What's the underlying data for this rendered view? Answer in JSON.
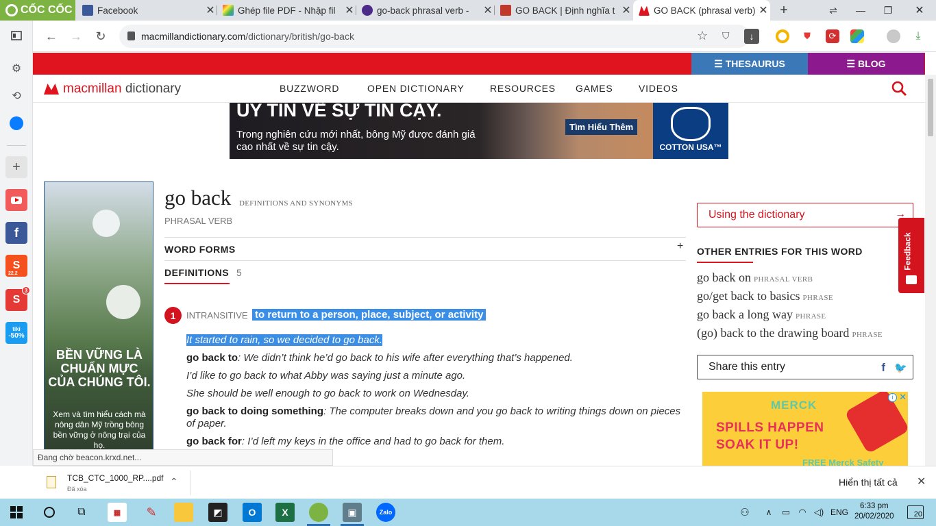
{
  "tabs": [
    {
      "title": "Facebook",
      "icon": "facebook-icon",
      "color": "#3b5998"
    },
    {
      "title": "Ghép file PDF - Nhập fil",
      "icon": "pdf-tool-icon",
      "color": "#e4405f"
    },
    {
      "title": "go-back phrasal verb - ",
      "icon": "oxford-icon",
      "color": "#4b2a8a"
    },
    {
      "title": "GO BACK | Định nghĩa t",
      "icon": "cambridge-icon",
      "color": "#c0392b"
    },
    {
      "title": "GO BACK (phrasal verb)",
      "icon": "macmillan-icon",
      "color": "#e0141e"
    }
  ],
  "browser": {
    "brand": "CỐC CỐC",
    "url_domain": "macmillandictionary.com",
    "url_path": "/dictionary/british/go-back"
  },
  "site": {
    "logo_a": "macmillan",
    "logo_b": "dictionary",
    "thesaurus": "THESAURUS",
    "blog": "BLOG",
    "nav": [
      "BUZZWORD",
      "OPEN DICTIONARY",
      "RESOURCES",
      "GAMES",
      "VIDEOS"
    ]
  },
  "top_ad": {
    "headline": "UY TÍN VỀ SỰ TIN CẬY.",
    "body": "Trong nghiên cứu mới nhất, bông Mỹ được đánh giá cao nhất về sự tin cậy.",
    "cta": "Tìm Hiểu Thêm",
    "brand": "COTTON USA™"
  },
  "left_ad": {
    "headline": "BỀN VỮNG LÀ CHUẨN MỰC CỦA CHÚNG TÔI.",
    "body": "Xem và tìm hiểu cách mà nông dân Mỹ trồng bông bền vững ở nông trại của họ."
  },
  "entry": {
    "word": "go back",
    "word_sub": "DEFINITIONS AND SYNONYMS",
    "pos": "PHRASAL VERB",
    "word_forms": "WORD FORMS",
    "definitions_label": "DEFINITIONS",
    "definitions_count": "5",
    "sense_number": "1",
    "grammar": "INTRANSITIVE",
    "definition": "to return to a person, place, subject, or activity",
    "examples": [
      {
        "pattern": "",
        "text": "It started to rain, so we decided to go back."
      },
      {
        "pattern": "go back to",
        "text": ": We didn’t think he’d go back to his wife after everything that’s happened."
      },
      {
        "pattern": "",
        "text": "I’d like to go back to what Abby was saying just a minute ago."
      },
      {
        "pattern": "",
        "text": "She should be well enough to go back to work on Wednesday."
      },
      {
        "pattern": "go back to doing something",
        "text": ": The computer breaks down and you go back to writing things down on pieces of paper."
      },
      {
        "pattern": "go back for",
        "text": ": I’d left my keys in the office and had to go back for them."
      }
    ]
  },
  "right": {
    "using": "Using the dictionary",
    "other_heading": "OTHER ENTRIES FOR THIS WORD",
    "other_entries": [
      {
        "text": "go back on",
        "pos": "PHRASAL VERB"
      },
      {
        "text": "go/get back to basics",
        "pos": "PHRASE"
      },
      {
        "text": "go back a long way",
        "pos": "PHRASE"
      },
      {
        "text": "(go) back to the drawing board",
        "pos": "PHRASE"
      }
    ],
    "share": "Share this entry"
  },
  "merck_ad": {
    "brand": "MERCK",
    "line1": "SPILLS HAPPEN",
    "line2": "SOAK IT UP!",
    "line3": "FREE Merck Safety"
  },
  "feedback": "Feedback",
  "status_text": "Đang chờ beacon.krxd.net...",
  "download": {
    "file": "TCB_CTC_1000_RP....pdf",
    "state": "Đã xóa",
    "show_all": "Hiển thị tất cả"
  },
  "taskbar": {
    "lang": "ENG",
    "time": "6:33 pm",
    "date": "20/02/2020",
    "notifications": "20"
  },
  "sidebar_badges": {
    "shopee": "22.2",
    "messages": "3",
    "tiki": "-50%"
  }
}
